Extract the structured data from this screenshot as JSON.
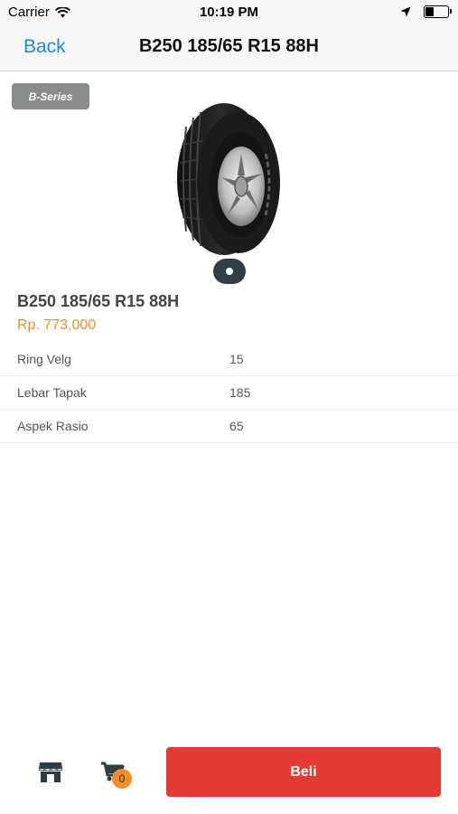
{
  "status_bar": {
    "carrier": "Carrier",
    "time": "10:19 PM",
    "icons": [
      "wifi-icon",
      "location-arrow-icon",
      "battery-icon"
    ]
  },
  "nav": {
    "back_label": "Back",
    "title": "B250 185/65 R15 88H"
  },
  "hero": {
    "badge": "B-Series",
    "image": "tire-image",
    "pager_dots": 1
  },
  "product": {
    "name": "B250 185/65 R15 88H",
    "price": "Rp. 773,000"
  },
  "specs": [
    {
      "label": "Ring Velg",
      "value": "15"
    },
    {
      "label": "Lebar Tapak",
      "value": "185"
    },
    {
      "label": "Aspek Rasio",
      "value": "65"
    }
  ],
  "bottom_bar": {
    "store_icon": "store-icon",
    "cart_icon": "cart-icon",
    "cart_count": "0",
    "buy_label": "Beli"
  },
  "colors": {
    "accent_blue": "#1e88e5",
    "price_orange": "#f28c28",
    "buy_red": "#e53935",
    "badge_gray": "#8a8c8b"
  }
}
